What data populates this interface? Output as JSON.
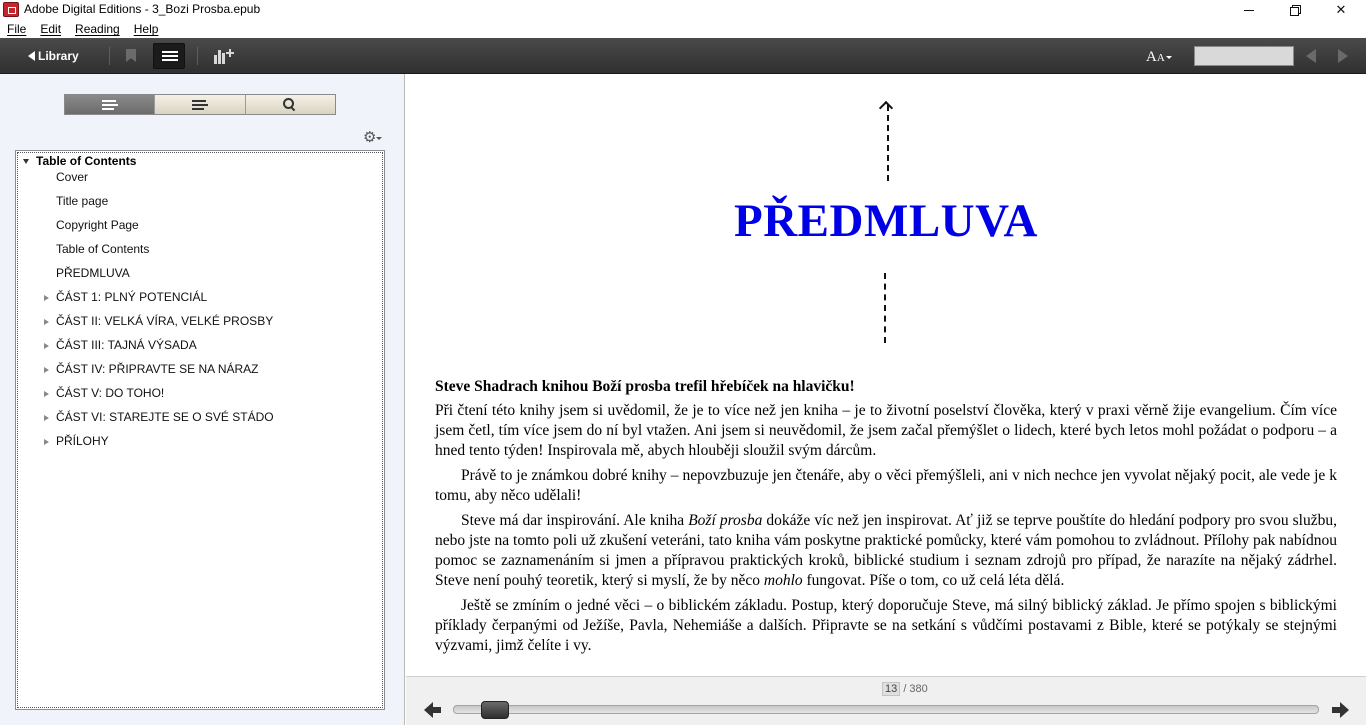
{
  "window": {
    "title": "Adobe Digital Editions - 3_Bozi Prosba.epub",
    "minimize_glyph": "—",
    "maximize_glyph": "□",
    "close_glyph": "✕"
  },
  "menu": [
    "File",
    "Edit",
    "Reading",
    "Help"
  ],
  "toolbar": {
    "library_label": "Library",
    "font_size_label": "A",
    "font_size_small": "A",
    "search_value": ""
  },
  "sidebar": {
    "toc_title": "Table of Contents",
    "items": [
      {
        "label": "Cover",
        "expandable": false
      },
      {
        "label": "Title page",
        "expandable": false
      },
      {
        "label": "Copyright Page",
        "expandable": false
      },
      {
        "label": "Table of Contents",
        "expandable": false
      },
      {
        "label": "PŘEDMLUVA",
        "expandable": false
      },
      {
        "label": "ČÁST 1: PLNÝ POTENCIÁL",
        "expandable": true
      },
      {
        "label": "ČÁST II: VELKÁ VÍRA, VELKÉ PROSBY",
        "expandable": true
      },
      {
        "label": "ČÁST III: TAJNÁ VÝSADA",
        "expandable": true
      },
      {
        "label": "ČÁST IV: PŘIPRAVTE SE NA NÁRAZ",
        "expandable": true
      },
      {
        "label": "ČÁST V: DO TOHO!",
        "expandable": true
      },
      {
        "label": "ČÁST VI: STAREJTE SE O SVÉ STÁDO",
        "expandable": true
      },
      {
        "label": "PŘÍLOHY",
        "expandable": true
      }
    ]
  },
  "reader": {
    "chapter_title": "PŘEDMLUVA",
    "lead": "Steve Shadrach knihou Boží prosba trefil hřebíček na hlavičku!",
    "p1": "Při čtení této knihy jsem si uvědomil, že je to více než jen kniha – je to životní poselství člověka, který v praxi věrně žije evangelium. Čím více jsem četl, tím více jsem do ní byl vtažen. Ani jsem si neuvědomil, že jsem začal přemýšlet o lidech, které bych letos mohl požádat o podporu – a hned tento týden! Inspirovala mě, abych hlouběji sloužil svým dárcům.",
    "p2": "Právě to je známkou dobré knihy – nepovzbuzuje jen čtenáře, aby o věci přemýšleli, ani v nich nechce jen vyvolat nějaký pocit, ale vede je k tomu, aby něco udělali!",
    "p3_a": "Steve má dar inspirování. Ale kniha ",
    "p3_em1": "Boží prosba",
    "p3_b": " dokáže víc než jen inspirovat. Ať již se teprve pouštíte do hledání podpory pro svou službu, nebo jste na tomto poli už zkušení veteráni, tato kniha vám poskytne praktické pomůcky, které vám pomohou to zvládnout. Přílohy pak nabídnou pomoc se zaznamenáním si jmen a přípravou praktických kroků, biblické studium i seznam zdrojů pro případ, že narazíte na nějaký zádrhel. Steve není pouhý teoretik, který si myslí, že by něco ",
    "p3_em2": "mohlo",
    "p3_c": " fungovat. Píše o tom, co už celá léta dělá.",
    "p4": "Ještě se zmíním o jedné věci – o biblickém základu. Postup, který doporučuje Steve, má silný biblický základ. Je přímo spojen s biblickými příklady čerpanými od Ježíše, Pavla, Nehemiáše a dalších. Připravte se na setkání s vůdčími postavami z Bible, které se potýkaly se stejnými výzvami, jimž čelíte i vy."
  },
  "footer": {
    "current_page": "13",
    "total_pages": "/ 380",
    "progress_fraction": 0.034
  },
  "colors": {
    "chapter_title": "#0000e6",
    "toolbar": "#3a3a3a",
    "sidebar_bg": "#f0f3f9"
  }
}
